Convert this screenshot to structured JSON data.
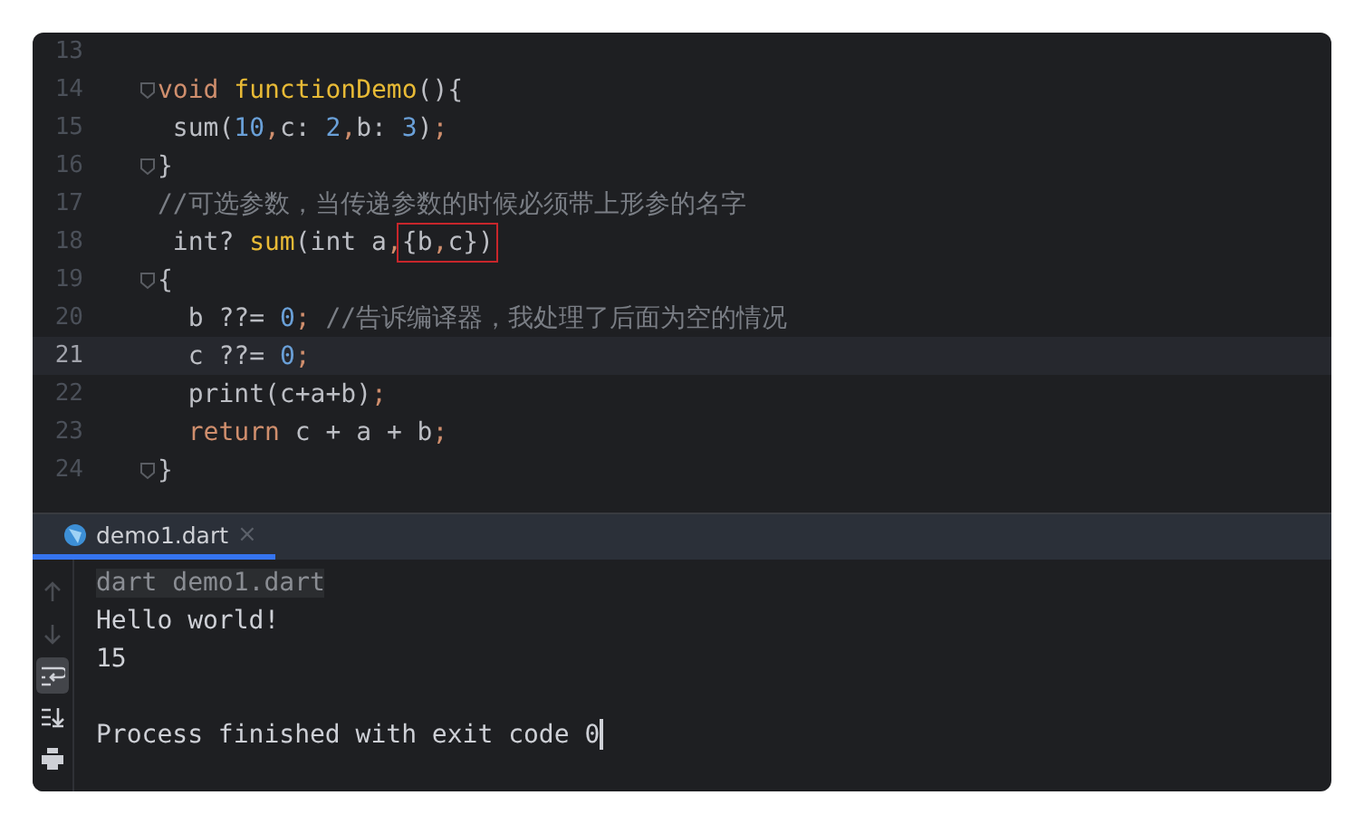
{
  "editor": {
    "lines": [
      {
        "number": "13",
        "current": false,
        "fold": false
      },
      {
        "number": "14",
        "current": false,
        "fold": true,
        "segments": [
          {
            "kind": "keyword",
            "text": "void"
          },
          {
            "kind": "function",
            "text": " functionDemo"
          },
          {
            "kind": "plain",
            "text": "(){"
          }
        ]
      },
      {
        "number": "15",
        "current": false,
        "fold": false,
        "segments": [
          {
            "kind": "plain",
            "text": " sum("
          },
          {
            "kind": "number",
            "text": "10"
          },
          {
            "kind": "keyword",
            "text": ","
          },
          {
            "kind": "plain",
            "text": "c: "
          },
          {
            "kind": "number",
            "text": "2"
          },
          {
            "kind": "keyword",
            "text": ","
          },
          {
            "kind": "plain",
            "text": "b: "
          },
          {
            "kind": "number",
            "text": "3"
          },
          {
            "kind": "plain",
            "text": ")"
          },
          {
            "kind": "keyword",
            "text": ";"
          }
        ]
      },
      {
        "number": "16",
        "current": false,
        "fold": true,
        "segments": [
          {
            "kind": "plain",
            "text": "}"
          }
        ]
      },
      {
        "number": "17",
        "current": false,
        "fold": false,
        "segments": [
          {
            "kind": "comment",
            "text": "//可选参数，当传递参数的时候必须带上形参的名字"
          }
        ]
      },
      {
        "number": "18",
        "current": false,
        "fold": false,
        "segments": [
          {
            "kind": "plain",
            "text": " int? "
          },
          {
            "kind": "function",
            "text": "sum"
          },
          {
            "kind": "plain",
            "text": "(int a"
          },
          {
            "kind": "keyword",
            "text": ","
          },
          {
            "kind": "group",
            "marked": true,
            "segments": [
              {
                "kind": "plain",
                "text": "{b"
              },
              {
                "kind": "keyword",
                "text": ","
              },
              {
                "kind": "plain",
                "text": "c})"
              }
            ]
          }
        ]
      },
      {
        "number": "19",
        "current": false,
        "fold": true,
        "segments": [
          {
            "kind": "plain",
            "text": "{"
          }
        ]
      },
      {
        "number": "20",
        "current": false,
        "fold": false,
        "segments": [
          {
            "kind": "plain",
            "text": "  b ??= "
          },
          {
            "kind": "number",
            "text": "0"
          },
          {
            "kind": "keyword",
            "text": ";"
          },
          {
            "kind": "comment",
            "text": " //告诉编译器，我处理了后面为空的情况"
          }
        ]
      },
      {
        "number": "21",
        "current": true,
        "fold": false,
        "segments": [
          {
            "kind": "plain",
            "text": "  c ??= "
          },
          {
            "kind": "number",
            "text": "0"
          },
          {
            "kind": "keyword",
            "text": ";"
          }
        ]
      },
      {
        "number": "22",
        "current": false,
        "fold": false,
        "segments": [
          {
            "kind": "plain",
            "text": "  print(c+a+b)"
          },
          {
            "kind": "keyword",
            "text": ";"
          }
        ]
      },
      {
        "number": "23",
        "current": false,
        "fold": false,
        "segments": [
          {
            "kind": "keyword",
            "text": "  return"
          },
          {
            "kind": "plain",
            "text": " c + a + b"
          },
          {
            "kind": "keyword",
            "text": ";"
          }
        ]
      },
      {
        "number": "24",
        "current": false,
        "fold": true,
        "segments": [
          {
            "kind": "plain",
            "text": "}"
          }
        ]
      }
    ]
  },
  "run_panel": {
    "tabs": [
      {
        "label": "demo1.dart",
        "close": "×",
        "selected": true
      }
    ],
    "tools": [
      {
        "kind": "up",
        "disabled": true,
        "selected": false
      },
      {
        "kind": "down",
        "disabled": true,
        "selected": false
      },
      {
        "kind": "wrap",
        "disabled": false,
        "selected": true
      },
      {
        "kind": "scroll-end",
        "disabled": false,
        "selected": false
      },
      {
        "kind": "print",
        "disabled": false,
        "selected": false
      }
    ],
    "output": [
      {
        "kind": "command",
        "text": "dart demo1.dart"
      },
      {
        "kind": "output",
        "text": "Hello world!"
      },
      {
        "kind": "output",
        "text": "15"
      },
      {
        "kind": "status",
        "text": "Process finished with exit code 0",
        "caret": true
      }
    ]
  }
}
